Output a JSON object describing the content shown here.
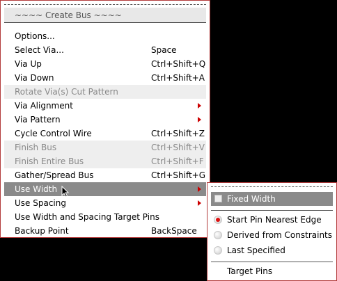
{
  "main_menu": {
    "title": "~~~~ Create Bus ~~~~",
    "items": [
      {
        "label": "Options...",
        "shortcut": "",
        "disabled": false,
        "submenu": false,
        "highlight": false
      },
      {
        "label": "Select Via...",
        "shortcut": "Space",
        "disabled": false,
        "submenu": false,
        "highlight": false
      },
      {
        "label": "Via Up",
        "shortcut": "Ctrl+Shift+Q",
        "disabled": false,
        "submenu": false,
        "highlight": false
      },
      {
        "label": "Via Down",
        "shortcut": "Ctrl+Shift+A",
        "disabled": false,
        "submenu": false,
        "highlight": false
      },
      {
        "label": "Rotate Via(s) Cut Pattern",
        "shortcut": "",
        "disabled": true,
        "submenu": false,
        "highlight": false
      },
      {
        "label": "Via Alignment",
        "shortcut": "",
        "disabled": false,
        "submenu": true,
        "highlight": false
      },
      {
        "label": "Via Pattern",
        "shortcut": "",
        "disabled": false,
        "submenu": true,
        "highlight": false
      },
      {
        "label": "Cycle Control Wire",
        "shortcut": "Ctrl+Shift+Z",
        "disabled": false,
        "submenu": false,
        "highlight": false
      },
      {
        "label": "Finish Bus",
        "shortcut": "Ctrl+Shift+V",
        "disabled": true,
        "submenu": false,
        "highlight": false
      },
      {
        "label": "Finish Entire Bus",
        "shortcut": "Ctrl+Shift+F",
        "disabled": true,
        "submenu": false,
        "highlight": false
      },
      {
        "label": "Gather/Spread Bus",
        "shortcut": "Ctrl+Shift+G",
        "disabled": false,
        "submenu": false,
        "highlight": false
      },
      {
        "label": "Use Width",
        "shortcut": "",
        "disabled": false,
        "submenu": true,
        "highlight": true
      },
      {
        "label": "Use Spacing",
        "shortcut": "",
        "disabled": false,
        "submenu": true,
        "highlight": false
      },
      {
        "label": "Use Width and Spacing Target Pins",
        "shortcut": "",
        "disabled": false,
        "submenu": false,
        "highlight": false
      },
      {
        "label": "Backup Point",
        "shortcut": "BackSpace",
        "disabled": false,
        "submenu": false,
        "highlight": false
      }
    ]
  },
  "submenu": {
    "fixed_width": {
      "label": "Fixed Width",
      "checked": false
    },
    "radios": [
      {
        "label": "Start Pin Nearest Edge",
        "selected": true
      },
      {
        "label": "Derived from Constraints",
        "selected": false
      },
      {
        "label": "Last Specified",
        "selected": false
      }
    ],
    "target_pins": "Target Pins"
  },
  "colors": {
    "border": "#b23a3a",
    "highlight": "#8a8a8a",
    "arrow": "#cc0000",
    "radio_dot": "#dd1111"
  }
}
